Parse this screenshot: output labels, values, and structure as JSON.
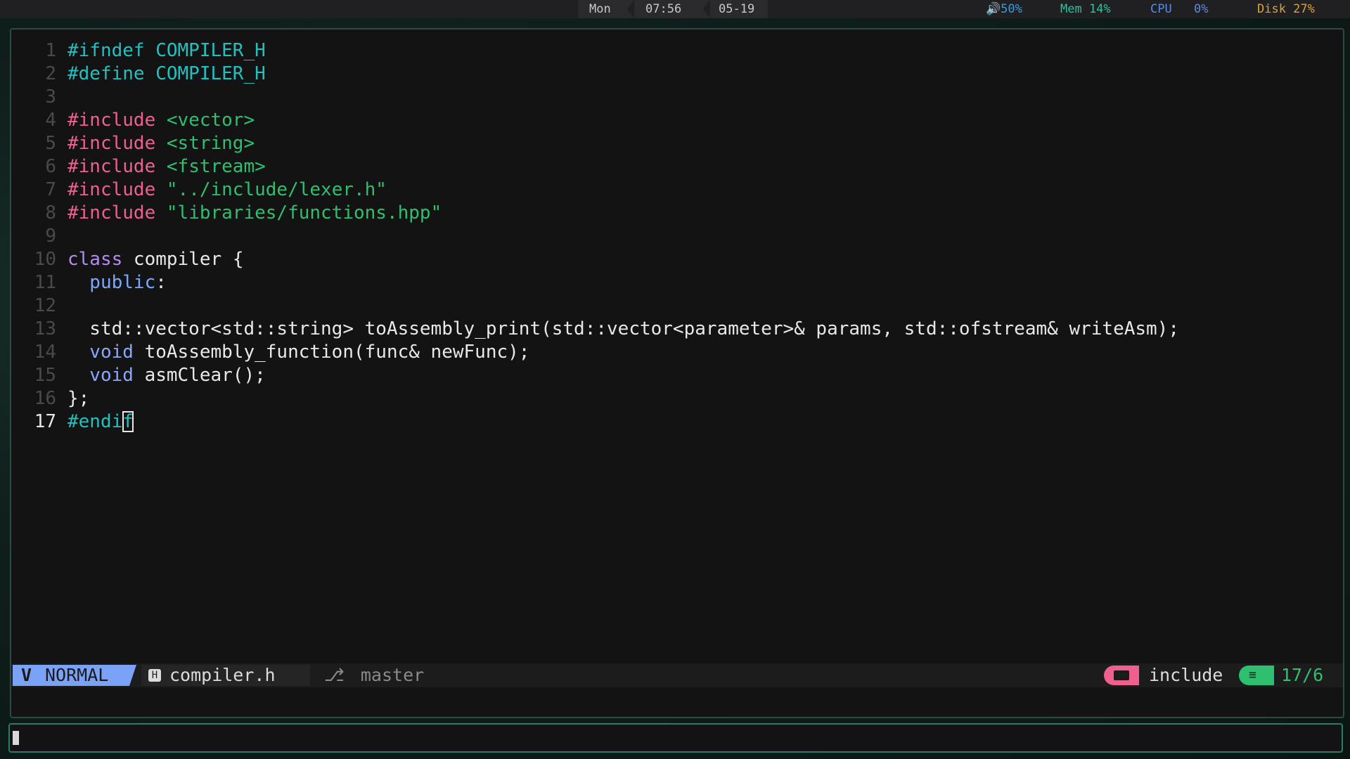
{
  "topbar": {
    "day": "Mon",
    "time": "07:56",
    "date": "05-19",
    "volume": "50%",
    "mem": "Mem 14%",
    "cpu_label": "CPU",
    "cpu_value": "0%",
    "disk": "Disk 27%"
  },
  "colors": {
    "preprocessor": "#23c0c0",
    "include": "#f0608e",
    "string": "#2fbf71",
    "keyword": "#b38cf0",
    "mode_bg": "#7aa2f7"
  },
  "editor": {
    "lines": [
      {
        "n": "1",
        "text": "#ifndef COMPILER_H"
      },
      {
        "n": "2",
        "text": "#define COMPILER_H"
      },
      {
        "n": "3",
        "text": ""
      },
      {
        "n": "4",
        "kw": "#include",
        "rest": " <vector>"
      },
      {
        "n": "5",
        "kw": "#include",
        "rest": " <string>"
      },
      {
        "n": "6",
        "kw": "#include",
        "rest": " <fstream>"
      },
      {
        "n": "7",
        "kw": "#include",
        "rest": " \"../include/lexer.h\""
      },
      {
        "n": "8",
        "kw": "#include",
        "rest": " \"libraries/functions.hpp\""
      },
      {
        "n": "9",
        "text": ""
      },
      {
        "n": "10",
        "kw": "class",
        "rest": " compiler {"
      },
      {
        "n": "11",
        "kw": "  public",
        "rest": ":"
      },
      {
        "n": "12",
        "text": ""
      },
      {
        "n": "13",
        "text": "  std::vector<std::string> toAssembly_print(std::vector<parameter>& params, std::ofstream& writeAsm);"
      },
      {
        "n": "14",
        "kw": "  void",
        "rest": " toAssembly_function(func& newFunc);"
      },
      {
        "n": "15",
        "kw": "  void",
        "rest": " asmClear();"
      },
      {
        "n": "16",
        "text": "};"
      },
      {
        "n": "17",
        "before": "#endi",
        "cursor": "f"
      }
    ]
  },
  "statusline": {
    "mode": "NORMAL",
    "file_icon": "H",
    "filename": "compiler.h",
    "branch": "master",
    "directory": "include",
    "position": "17/6"
  }
}
